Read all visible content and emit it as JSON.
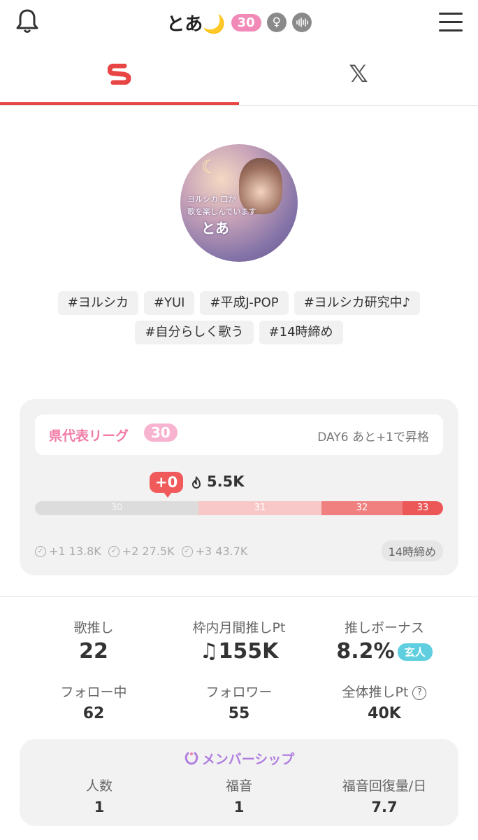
{
  "header": {
    "title": "とあ🌙",
    "level": "30",
    "gender_icon": "♀",
    "voice_icon": "waveform-icon"
  },
  "tabs": [
    {
      "name": "sing-app",
      "icon": "logo-s-icon",
      "active": true
    },
    {
      "name": "x",
      "label": "𝕏",
      "active": false
    }
  ],
  "profile": {
    "avatar_text_line1": "ヨルシカ 口か",
    "avatar_text_line2": "歌を楽しんでいます",
    "avatar_text_name": "とあ",
    "tags_row1": [
      "#ヨルシカ",
      "#YUI",
      "#平成J-POP",
      "#ヨルシカ研究中♪"
    ],
    "tags_row2": [
      "#自分らしく歌う",
      "#14時締め"
    ]
  },
  "league": {
    "name": "県代表リーグ",
    "level": "30",
    "day_status": "DAY6 あと+1で昇格",
    "delta": "+0",
    "score": "5.5K",
    "levels": [
      "30",
      "31",
      "32",
      "33"
    ],
    "milestones": [
      "+1 13.8K",
      "+2 27.5K",
      "+3 43.7K"
    ],
    "deadline": "14時締め"
  },
  "stats": {
    "uta_oshi_label": "歌推し",
    "uta_oshi_value": "22",
    "monthly_label": "枠内月間推しPt",
    "monthly_value": "♫155K",
    "bonus_label": "推しボーナス",
    "bonus_value": "8.2%",
    "bonus_badge": "玄人",
    "following_label": "フォロー中",
    "following_value": "62",
    "followers_label": "フォロワー",
    "followers_value": "55",
    "total_label": "全体推しPt",
    "total_help": "?",
    "total_value": "40K"
  },
  "membership": {
    "title": "メンバーシップ",
    "people_label": "人数",
    "people_value": "1",
    "gospel_label": "福音",
    "gospel_value": "1",
    "recovery_label": "福音回復量/日",
    "recovery_value": "7.7"
  },
  "colors": {
    "accent_red": "#e84545",
    "pink": "#f27aa6",
    "cyan_badge": "#5fcfdf",
    "membership_purple": "#b07ee0"
  }
}
